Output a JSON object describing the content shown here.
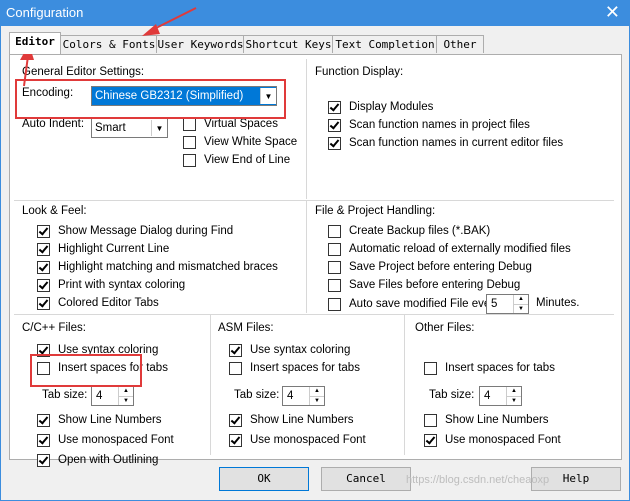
{
  "window": {
    "title": "Configuration",
    "close_icon": "close-icon"
  },
  "tabs": [
    {
      "label": "Editor",
      "active": true
    },
    {
      "label": "Colors & Fonts"
    },
    {
      "label": "User Keywords"
    },
    {
      "label": "Shortcut Keys"
    },
    {
      "label": "Text Completion"
    },
    {
      "label": "Other"
    }
  ],
  "general": {
    "title": "General Editor Settings:",
    "encoding_label": "Encoding:",
    "encoding_value": "Chinese GB2312 (Simplified)",
    "auto_indent_label": "Auto Indent:",
    "auto_indent_value": "Smart",
    "virtual_spaces": "Virtual Spaces",
    "view_white_space": "View White Space",
    "view_end_of_line": "View End of Line"
  },
  "function_display": {
    "title": "Function Display:",
    "display_modules": "Display Modules",
    "scan_project": "Scan function names in project files",
    "scan_current": "Scan function names in current editor files"
  },
  "look_feel": {
    "title": "Look & Feel:",
    "items": [
      "Show Message Dialog during Find",
      "Highlight Current Line",
      "Highlight matching and mismatched braces",
      "Print with syntax coloring",
      "Colored Editor Tabs"
    ]
  },
  "file_handling": {
    "title": "File & Project Handling:",
    "items": [
      "Create Backup files (*.BAK)",
      "Automatic reload of externally modified files",
      "Save Project before entering Debug",
      "Save Files before entering Debug"
    ],
    "auto_save_label": "Auto save modified File every",
    "auto_save_value": "5",
    "minutes_label": "Minutes."
  },
  "cpp": {
    "title": "C/C++ Files:",
    "use_syntax": "Use syntax coloring",
    "insert_spaces": "Insert spaces for tabs",
    "tab_size_label": "Tab size:",
    "tab_size_value": "4",
    "show_line_numbers": "Show Line Numbers",
    "monospaced": "Use monospaced Font",
    "outlining": "Open with Outlining"
  },
  "asm": {
    "title": "ASM Files:",
    "use_syntax": "Use syntax coloring",
    "insert_spaces": "Insert spaces for tabs",
    "tab_size_label": "Tab size:",
    "tab_size_value": "4",
    "show_line_numbers": "Show Line Numbers",
    "monospaced": "Use monospaced Font"
  },
  "other": {
    "title": "Other Files:",
    "insert_spaces": "Insert spaces for tabs",
    "tab_size_label": "Tab size:",
    "tab_size_value": "4",
    "show_line_numbers": "Show Line Numbers",
    "monospaced": "Use monospaced Font"
  },
  "buttons": {
    "ok": "OK",
    "cancel": "Cancel",
    "help": "Help"
  },
  "watermark": "https://blog.csdn.net/cheaoxp"
}
